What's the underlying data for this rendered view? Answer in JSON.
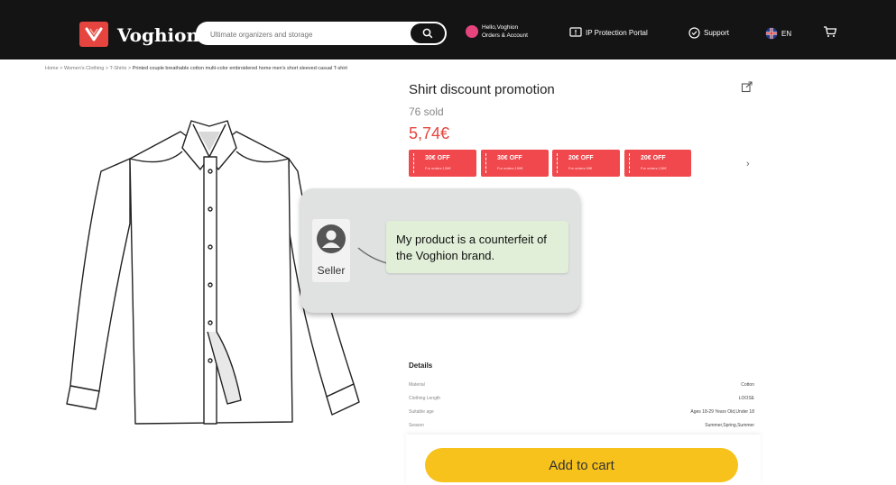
{
  "header": {
    "brand": "Voghion",
    "search_placeholder": "Ultimate organizers and storage",
    "account_line1": "Hello,Voghion",
    "account_line2": "Orders & Account",
    "ip_portal": "IP Protection Portal",
    "support": "Support",
    "language": "EN"
  },
  "breadcrumb": [
    "Home",
    "Women's Clothing",
    "T-Shirts",
    "Printed couple breathable cotton multi-color embroidered home men's short sleeved casual T-shirt"
  ],
  "product": {
    "title": "Shirt discount promotion",
    "sold": "76 sold",
    "price": "5,74€"
  },
  "coupons": [
    {
      "label": "30€ OFF",
      "sub": "For orders 139€"
    },
    {
      "label": "30€ OFF",
      "sub": "For orders 199€"
    },
    {
      "label": "20€ OFF",
      "sub": "For orders 99€"
    },
    {
      "label": "20€ OFF",
      "sub": "For orders 139€"
    }
  ],
  "popup": {
    "seller_label": "Seller",
    "message": "My product is a counterfeit of the Voghion brand."
  },
  "details": {
    "title": "Details",
    "rows": [
      {
        "key": "Material",
        "value": "Cotton"
      },
      {
        "key": "Clothing Length",
        "value": "LOOSE"
      },
      {
        "key": "Suitable age",
        "value": "Ages 18-29 Years Old,Under 18"
      },
      {
        "key": "Season",
        "value": "Summer,Spring,Summer"
      }
    ]
  },
  "cart": {
    "label": "Add to cart"
  },
  "colors": {
    "brand": "#e5453e",
    "topbar": "#141414",
    "cta": "#f7c21b",
    "coupon": "#f0484d",
    "bubble": "#e1efd8"
  }
}
